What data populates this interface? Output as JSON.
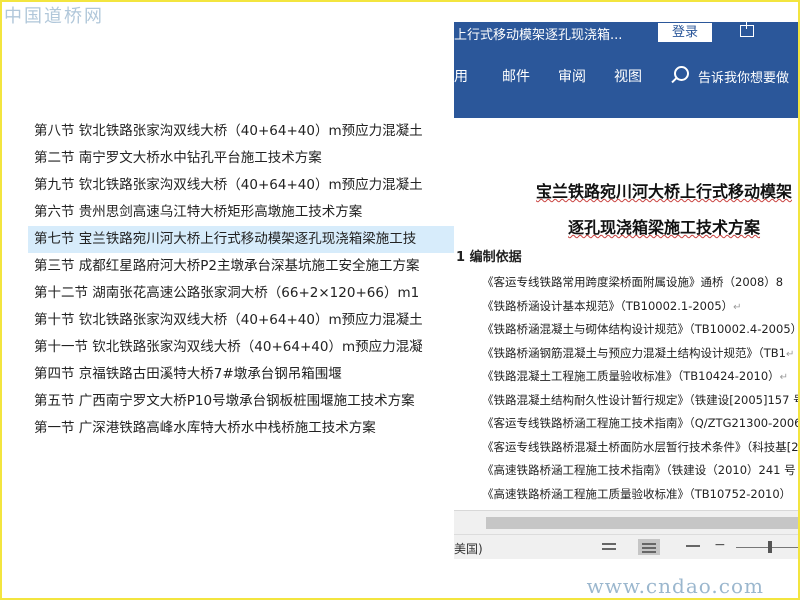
{
  "watermarks": {
    "top_logo": "中国道桥网",
    "bottom_logo": "www.cndao.com"
  },
  "file_list": [
    {
      "label": "第八节 钦北铁路张家沟双线大桥（40+64+40）m预应力混凝土",
      "selected": false
    },
    {
      "label": "第二节 南宁罗文大桥水中钻孔平台施工技术方案",
      "selected": false
    },
    {
      "label": "第九节 钦北铁路张家沟双线大桥（40+64+40）m预应力混凝土",
      "selected": false
    },
    {
      "label": "第六节 贵州思剑高速乌江特大桥矩形高墩施工技术方案",
      "selected": false
    },
    {
      "label": "第七节 宝兰铁路宛川河大桥上行式移动模架逐孔现浇箱梁施工技",
      "selected": true
    },
    {
      "label": "第三节 成都红星路府河大桥P2主墩承台深基坑施工安全施工方案",
      "selected": false
    },
    {
      "label": "第十二节 湖南张花高速公路张家洞大桥（66+2×120+66）m1",
      "selected": false
    },
    {
      "label": "第十节 钦北铁路张家沟双线大桥（40+64+40）m预应力混凝土",
      "selected": false
    },
    {
      "label": "第十一节 钦北铁路张家沟双线大桥（40+64+40）m预应力混凝",
      "selected": false
    },
    {
      "label": "第四节 京福铁路古田溪特大桥7#墩承台钢吊箱围堰",
      "selected": false
    },
    {
      "label": "第五节 广西南宁罗文大桥P10号墩承台钢板桩围堰施工技术方案",
      "selected": false
    },
    {
      "label": "第一节 广深港铁路高峰水库特大桥水中栈桥施工技术方案",
      "selected": false
    }
  ],
  "word": {
    "doc_title": "上行式移动模架逐孔现浇箱...",
    "login_label": "登录",
    "tabs": [
      "用",
      "邮件",
      "审阅",
      "视图"
    ],
    "tell_me": "告诉我你想要做",
    "heading_line1": "宝兰铁路宛川河大桥上行式移动模架",
    "heading_line2": "逐孔现浇箱梁施工技术方案",
    "section_heading": "1 编制依据",
    "references": [
      "《客运专线铁路常用跨度梁桥面附属设施》通桥（2008）8",
      "《铁路桥涵设计基本规范》（TB10002.1-2005）",
      "《铁路桥涵混凝土与砌体结构设计规范》（TB10002.4-2005）",
      "《铁路桥涵钢筋混凝土与预应力混凝土结构设计规范》（TB1",
      "《铁路混凝土工程施工质量验收标准》（TB10424-2010）",
      "《铁路混凝土结构耐久性设计暂行规定》（铁建设[2005]157 号",
      "《客运专线铁路桥涵工程施工技术指南》（Q/ZTG21300-2006",
      "《客运专线铁路桥混凝土桥面防水层暂行技术条件》（科技基[2",
      "《高速铁路桥涵工程施工技术指南》（铁建设（2010）241 号",
      "《高速铁路桥涵工程施工质量验收标准》（TB10752-2010）"
    ],
    "return_mark": "↵",
    "status_language": "美国)"
  }
}
